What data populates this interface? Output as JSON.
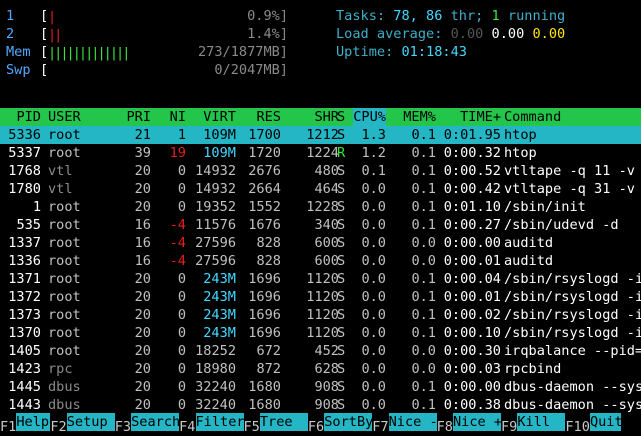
{
  "meters": [
    {
      "label": "1",
      "fill": "|",
      "value": "0.9%]",
      "fill_color": "#e02020",
      "level_pct": 0.9
    },
    {
      "label": "2",
      "fill": "||",
      "value": "1.4%]",
      "fill_color": "#e02020",
      "level_pct": 1.4
    },
    {
      "label": "Mem",
      "fill": "|||||||||||||",
      "value": "273/1877MB]",
      "fill_color": "#39e63b",
      "level_pct": 14.5
    },
    {
      "label": "Swp",
      "fill": "",
      "value": "0/2047MB]",
      "fill_color": "#e02020",
      "level_pct": 0
    }
  ],
  "stats": {
    "tasks_label": "Tasks:",
    "tasks_count": "78,",
    "threads": "86",
    "thr_label": "thr;",
    "running": "1",
    "running_label": "running",
    "load_label": "Load average:",
    "load1": "0.00",
    "load5": "0.00",
    "load15": "0.00",
    "uptime_label": "Uptime:",
    "uptime": "01:18:43"
  },
  "columns": {
    "pid": "PID",
    "user": "USER",
    "pri": "PRI",
    "ni": "NI",
    "virt": "VIRT",
    "res": "RES",
    "shr": "SHR",
    "s": "S",
    "cpu": "CPU%",
    "mem": "MEM%",
    "time": "TIME+",
    "cmd": "Command"
  },
  "processes": [
    {
      "pid": "5336",
      "user": "root",
      "pri": "21",
      "ni": "1",
      "virt": "109M",
      "res": "1700",
      "shr": "1212",
      "s": "S",
      "cpu": "1.3",
      "mem": "0.1",
      "time": "0:01.95",
      "cmd": "htop"
    },
    {
      "pid": "5337",
      "user": "root",
      "pri": "39",
      "ni": "19",
      "virt": "109M",
      "res": "1720",
      "shr": "1224",
      "s": "R",
      "cpu": "1.2",
      "mem": "0.1",
      "time": "0:00.32",
      "cmd": "htop"
    },
    {
      "pid": "1768",
      "user": "vtl",
      "pri": "20",
      "ni": "0",
      "virt": "14932",
      "res": "2676",
      "shr": "480",
      "s": "S",
      "cpu": "0.1",
      "mem": "0.1",
      "time": "0:00.52",
      "cmd": "vtltape -q 11 -v"
    },
    {
      "pid": "1780",
      "user": "vtl",
      "pri": "20",
      "ni": "0",
      "virt": "14932",
      "res": "2664",
      "shr": "464",
      "s": "S",
      "cpu": "0.0",
      "mem": "0.1",
      "time": "0:00.42",
      "cmd": "vtltape -q 31 -v"
    },
    {
      "pid": "1",
      "user": "root",
      "pri": "20",
      "ni": "0",
      "virt": "19352",
      "res": "1552",
      "shr": "1228",
      "s": "S",
      "cpu": "0.0",
      "mem": "0.1",
      "time": "0:01.10",
      "cmd": "/sbin/init"
    },
    {
      "pid": "535",
      "user": "root",
      "pri": "16",
      "ni": "-4",
      "virt": "11576",
      "res": "1676",
      "shr": "340",
      "s": "S",
      "cpu": "0.0",
      "mem": "0.1",
      "time": "0:00.27",
      "cmd": "/sbin/udevd -d"
    },
    {
      "pid": "1337",
      "user": "root",
      "pri": "16",
      "ni": "-4",
      "virt": "27596",
      "res": "828",
      "shr": "600",
      "s": "S",
      "cpu": "0.0",
      "mem": "0.0",
      "time": "0:00.00",
      "cmd": "auditd"
    },
    {
      "pid": "1336",
      "user": "root",
      "pri": "16",
      "ni": "-4",
      "virt": "27596",
      "res": "828",
      "shr": "600",
      "s": "S",
      "cpu": "0.0",
      "mem": "0.0",
      "time": "0:00.01",
      "cmd": "auditd"
    },
    {
      "pid": "1371",
      "user": "root",
      "pri": "20",
      "ni": "0",
      "virt": "243M",
      "res": "1696",
      "shr": "1120",
      "s": "S",
      "cpu": "0.0",
      "mem": "0.1",
      "time": "0:00.04",
      "cmd": "/sbin/rsyslogd -i"
    },
    {
      "pid": "1372",
      "user": "root",
      "pri": "20",
      "ni": "0",
      "virt": "243M",
      "res": "1696",
      "shr": "1120",
      "s": "S",
      "cpu": "0.0",
      "mem": "0.1",
      "time": "0:00.01",
      "cmd": "/sbin/rsyslogd -i"
    },
    {
      "pid": "1373",
      "user": "root",
      "pri": "20",
      "ni": "0",
      "virt": "243M",
      "res": "1696",
      "shr": "1120",
      "s": "S",
      "cpu": "0.0",
      "mem": "0.1",
      "time": "0:00.02",
      "cmd": "/sbin/rsyslogd -i"
    },
    {
      "pid": "1370",
      "user": "root",
      "pri": "20",
      "ni": "0",
      "virt": "243M",
      "res": "1696",
      "shr": "1120",
      "s": "S",
      "cpu": "0.0",
      "mem": "0.1",
      "time": "0:00.10",
      "cmd": "/sbin/rsyslogd -i"
    },
    {
      "pid": "1405",
      "user": "root",
      "pri": "20",
      "ni": "0",
      "virt": "18252",
      "res": "672",
      "shr": "452",
      "s": "S",
      "cpu": "0.0",
      "mem": "0.0",
      "time": "0:00.30",
      "cmd": "irqbalance --pid="
    },
    {
      "pid": "1423",
      "user": "rpc",
      "pri": "20",
      "ni": "0",
      "virt": "18980",
      "res": "872",
      "shr": "628",
      "s": "S",
      "cpu": "0.0",
      "mem": "0.0",
      "time": "0:00.03",
      "cmd": "rpcbind"
    },
    {
      "pid": "1445",
      "user": "dbus",
      "pri": "20",
      "ni": "0",
      "virt": "32240",
      "res": "1680",
      "shr": "908",
      "s": "S",
      "cpu": "0.0",
      "mem": "0.1",
      "time": "0:00.00",
      "cmd": "dbus-daemon --sys"
    },
    {
      "pid": "1443",
      "user": "dbus",
      "pri": "20",
      "ni": "0",
      "virt": "32240",
      "res": "1680",
      "shr": "908",
      "s": "S",
      "cpu": "0.0",
      "mem": "0.1",
      "time": "0:00.38",
      "cmd": "dbus-daemon --sys"
    }
  ],
  "footer": [
    {
      "key": "F1",
      "label": "Help"
    },
    {
      "key": "F2",
      "label": "Setup"
    },
    {
      "key": "F3",
      "label": "Search"
    },
    {
      "key": "F4",
      "label": "Filter"
    },
    {
      "key": "F5",
      "label": "Tree"
    },
    {
      "key": "F6",
      "label": "SortBy"
    },
    {
      "key": "F7",
      "label": "Nice -"
    },
    {
      "key": "F8",
      "label": "Nice +"
    },
    {
      "key": "F9",
      "label": "Kill"
    },
    {
      "key": "F10",
      "label": "Quit"
    }
  ]
}
